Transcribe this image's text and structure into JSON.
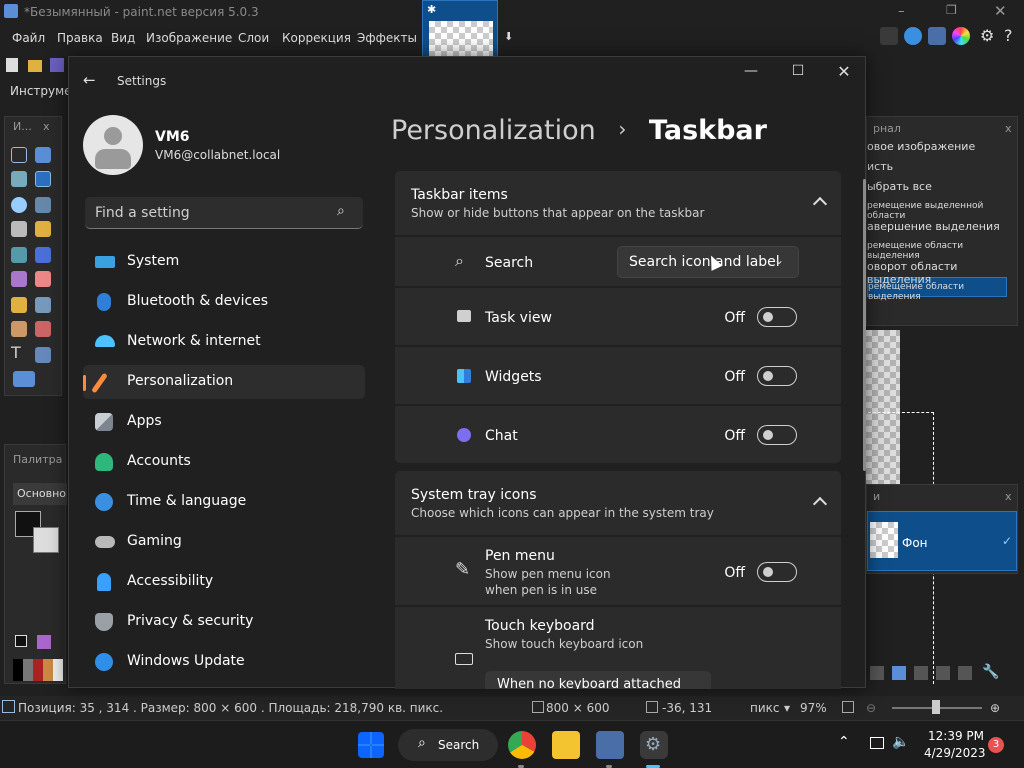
{
  "pdn": {
    "title": "*Безымянный - paint.net версия 5.0.3",
    "menu": [
      "Файл",
      "Правка",
      "Вид",
      "Изображение",
      "Слои",
      "Коррекция",
      "Эффекты"
    ],
    "toolbar_label": "Инструмен",
    "tools_title": "И...",
    "palette_title": "Палитра",
    "palette_mode": "Основно",
    "history_title": "рнал",
    "history_items": [
      "овое изображение",
      "исть",
      "ыбрать все",
      "ремещение выделенной области",
      "авершение выделения",
      "ремещение области выделения",
      "оворот области выделения",
      "ремещение области выделения"
    ],
    "layers_title": "и",
    "layer_name": "Фон",
    "status": {
      "position": "Позиция: 35 , 314 . Размер: 800 × 600 . Площадь: 218,790 кв. пикс.",
      "size": "800 × 600",
      "coords": "-36, 131",
      "unit": "пикс",
      "zoom": "97%"
    }
  },
  "settings": {
    "window_title": "Settings",
    "user": {
      "name": "VM6",
      "email": "VM6@collabnet.local"
    },
    "search_placeholder": "Find a setting",
    "nav": [
      {
        "label": "System",
        "color": "#3aa0e0"
      },
      {
        "label": "Bluetooth & devices",
        "color": "#2f7fd8"
      },
      {
        "label": "Network & internet",
        "color": "#4cc2ff"
      },
      {
        "label": "Personalization",
        "color": "#ff8a3c"
      },
      {
        "label": "Apps",
        "color": "#9aa0a6"
      },
      {
        "label": "Accounts",
        "color": "#2fb67a"
      },
      {
        "label": "Time & language",
        "color": "#3a8fe0"
      },
      {
        "label": "Gaming",
        "color": "#b9b9b9"
      },
      {
        "label": "Accessibility",
        "color": "#3aa0ff"
      },
      {
        "label": "Privacy & security",
        "color": "#9aa0a6"
      },
      {
        "label": "Windows Update",
        "color": "#2f8fe8"
      }
    ],
    "breadcrumb": {
      "parent": "Personalization",
      "sep": "›",
      "current": "Taskbar"
    },
    "taskbar_items": {
      "title": "Taskbar items",
      "subtitle": "Show or hide buttons that appear on the taskbar"
    },
    "search_row": {
      "label": "Search",
      "value": "Search icon and label"
    },
    "task_view": {
      "label": "Task view",
      "state": "Off"
    },
    "widgets": {
      "label": "Widgets",
      "state": "Off"
    },
    "chat": {
      "label": "Chat",
      "state": "Off"
    },
    "tray": {
      "title": "System tray icons",
      "subtitle": "Choose which icons can appear in the system tray"
    },
    "pen_menu": {
      "label": "Pen menu",
      "sub1": "Show pen menu icon",
      "sub2": "when pen is in use",
      "state": "Off"
    },
    "touch_keyboard": {
      "label": "Touch keyboard",
      "sub": "Show touch keyboard icon",
      "value": "When no keyboard attached"
    }
  },
  "taskbar": {
    "search_label": "Search",
    "time": "12:39 PM",
    "date": "4/29/2023",
    "notifications": "3"
  }
}
